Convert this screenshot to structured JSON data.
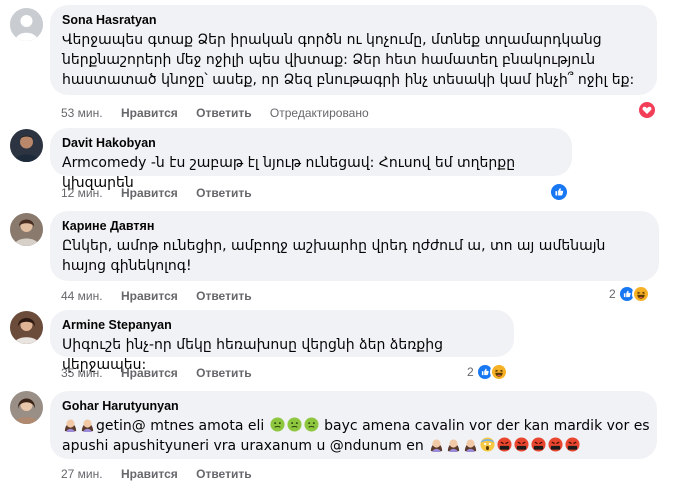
{
  "comments": [
    {
      "author": "Sona Hasratyan",
      "text": "Վերջապես գտաք Ձեր իրական գործն ու կոչումը, մտնեք տղամարդկանց ներքնաշորերի մեջ ոջիլի պես վխտաք: Ձեր հետ համատեղ բնակություն հաստատած կնոջը՝ ասեք, որ Ձեզ բնութագրի ինչ տեսակի կամ ինչի՞ ոջիլ եք:",
      "time": "53 мин.",
      "like": "Нравится",
      "reply": "Ответить",
      "edited": "Отредактировано",
      "reaction_count": ""
    },
    {
      "author": "Davit Hakobyan",
      "text": "Armcomedy -ն էս շաբաթ էլ նյութ ունեցավ: Հուսով եմ տղերքը կխզարեն",
      "time": "12 мин.",
      "like": "Нравится",
      "reply": "Ответить",
      "reaction_count": ""
    },
    {
      "author": "Карине Давтян",
      "text": "Ընկեր, ամոթ ունեցիր, ամբողջ աշխարհը վրեդ ղժժում ա, տո այ ամենայն հայոց գինեկոլոգ!",
      "time": "44 мин.",
      "like": "Нравится",
      "reply": "Ответить",
      "reaction_count": "2"
    },
    {
      "author": "Armine Stepanyan",
      "text": "Սիգուշե ինչ-որ մեկը հեռախոսը վերցնի ձեր ձեռքից վերջապես:",
      "time": "35 мин.",
      "like": "Нравится",
      "reply": "Ответить",
      "reaction_count": "2"
    },
    {
      "author": "Gohar Harutyunyan",
      "line1_a": "getin@ mtnes amota eli",
      "line1_b": "bayc amena cavalin vor der kan mardik vor es",
      "line2_a": "apushi apushityuneri vra uraxanum u @ndunum en",
      "time": "27 мин.",
      "like": "Нравится",
      "reply": "Ответить"
    }
  ],
  "colors": {
    "bubble": "#f0f2f5",
    "meta": "#65676b",
    "like_blue": "#1877f2",
    "love_red": "#f33e58"
  }
}
